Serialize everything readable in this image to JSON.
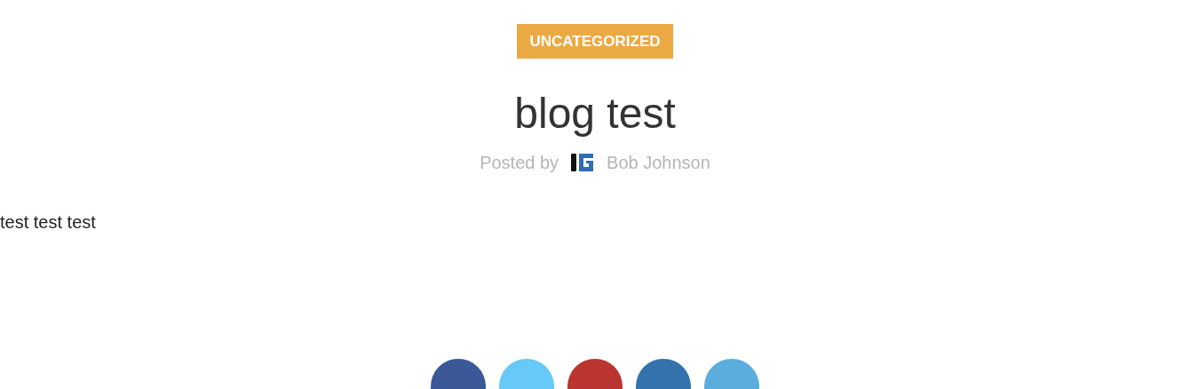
{
  "category": "UNCATEGORIZED",
  "title": "blog test",
  "byline": {
    "prefix": "Posted by",
    "author": "Bob Johnson"
  },
  "body": "test test test",
  "share_buttons": [
    {
      "color": "#3b5998"
    },
    {
      "color": "#66c9f7"
    },
    {
      "color": "#bb3530"
    },
    {
      "color": "#3273ae"
    },
    {
      "color": "#5aaddc"
    }
  ]
}
